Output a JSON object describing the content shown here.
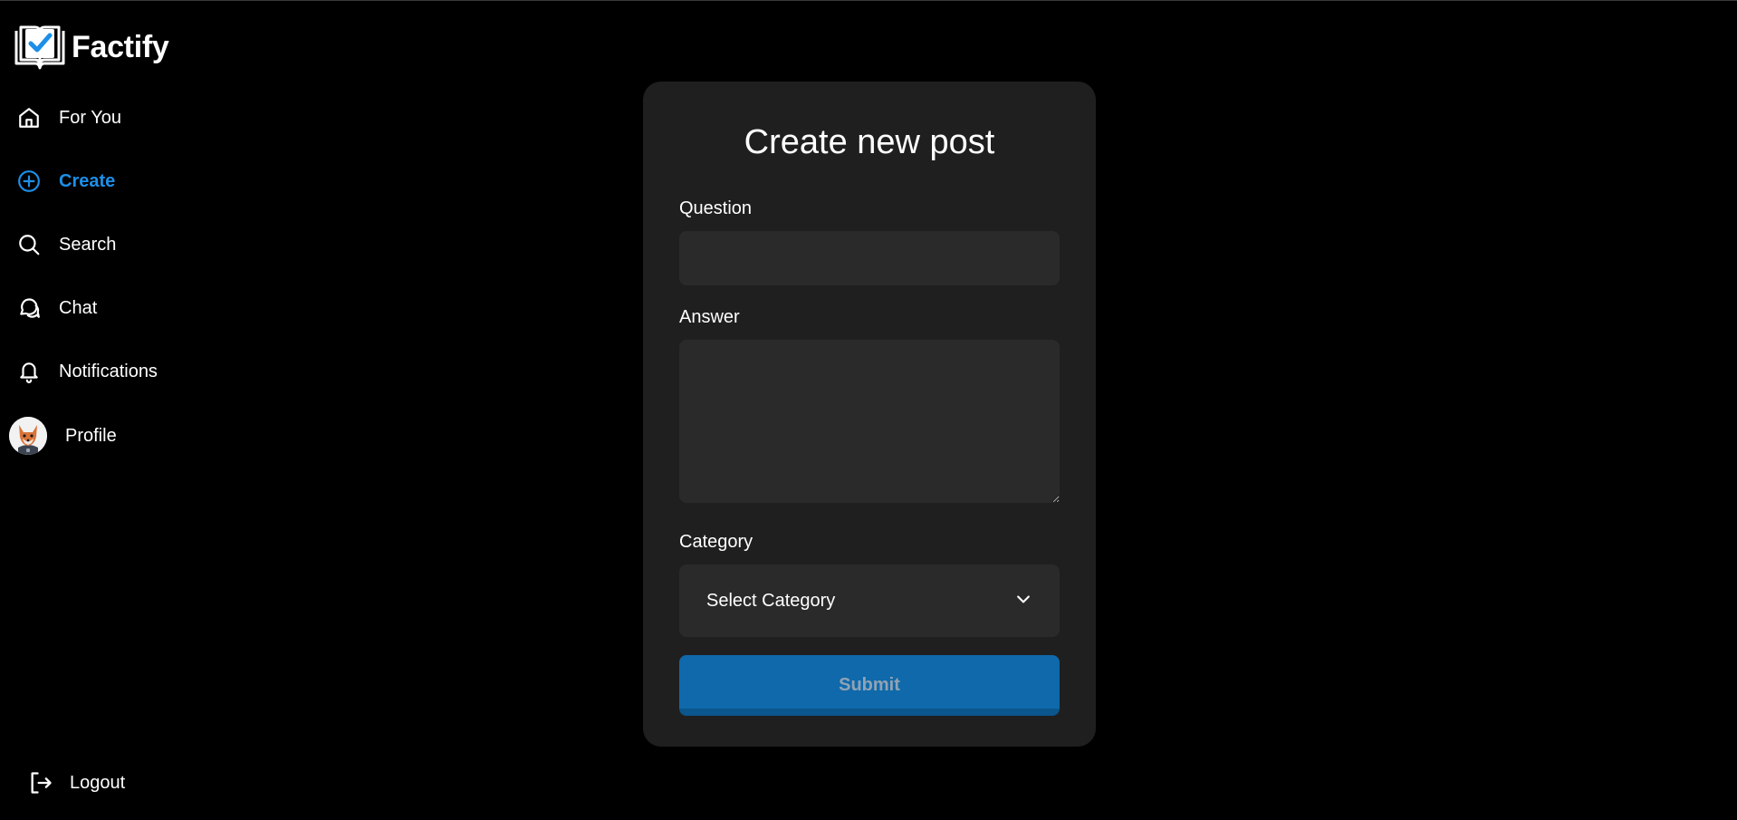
{
  "app": {
    "name": "Factify"
  },
  "sidebar": {
    "items": [
      {
        "label": "For You",
        "icon": "home-icon"
      },
      {
        "label": "Create",
        "icon": "plus-circle-icon",
        "active": true
      },
      {
        "label": "Search",
        "icon": "search-icon"
      },
      {
        "label": "Chat",
        "icon": "chat-icon"
      },
      {
        "label": "Notifications",
        "icon": "bell-icon"
      },
      {
        "label": "Profile",
        "icon": "avatar"
      }
    ],
    "logout": {
      "label": "Logout",
      "icon": "logout-icon"
    }
  },
  "form": {
    "title": "Create new post",
    "question": {
      "label": "Question",
      "value": ""
    },
    "answer": {
      "label": "Answer",
      "value": ""
    },
    "category": {
      "label": "Category",
      "selected": "Select Category"
    },
    "submit_label": "Submit"
  },
  "colors": {
    "background": "#000000",
    "card": "#1f1f1f",
    "input": "#2a2a2a",
    "accent": "#1d8fe8",
    "submit": "#0f69aa"
  }
}
